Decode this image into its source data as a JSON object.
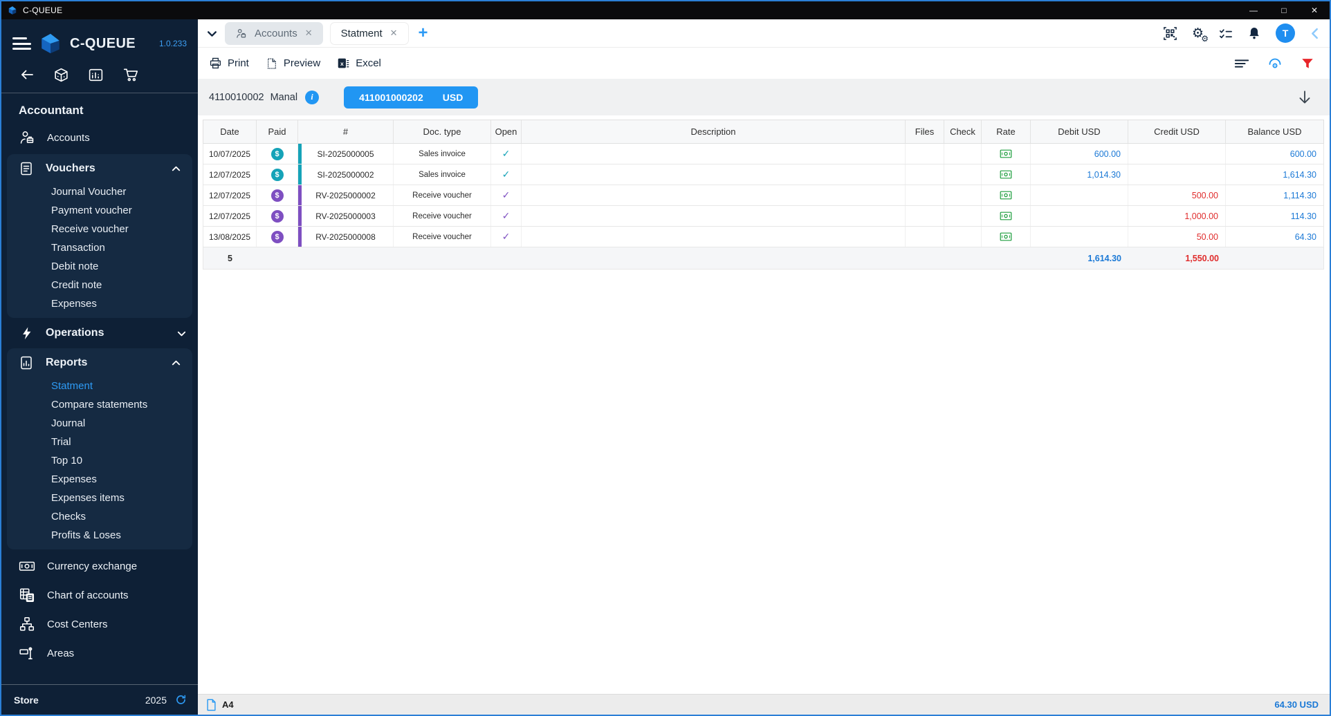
{
  "titlebar": {
    "app_name": "C-QUEUE",
    "minimize": "—",
    "maximize": "□",
    "close": "✕"
  },
  "sidebar": {
    "brand": "C-QUEUE",
    "version": "1.0.233",
    "heading": "Accountant",
    "accounts_label": "Accounts",
    "vouchers": {
      "label": "Vouchers",
      "items": [
        "Journal Voucher",
        "Payment voucher",
        "Receive voucher",
        "Transaction",
        "Debit note",
        "Credit note",
        "Expenses"
      ]
    },
    "operations_label": "Operations",
    "reports": {
      "label": "Reports",
      "items": [
        "Statment",
        "Compare statements",
        "Journal",
        "Trial",
        "Top 10",
        "Expenses",
        "Expenses items",
        "Checks",
        "Profits & Loses"
      ]
    },
    "links": [
      "Currency exchange",
      "Chart of accounts",
      "Cost Centers",
      "Areas"
    ],
    "footer": {
      "store": "Store",
      "year": "2025"
    }
  },
  "tabs": {
    "accounts": "Accounts",
    "statement": "Statment",
    "close": "✕",
    "add": "+"
  },
  "header_icons": {
    "avatar_letter": "T",
    "gear": "⚙"
  },
  "toolbar": {
    "print": "Print",
    "preview": "Preview",
    "excel": "Excel"
  },
  "account_bar": {
    "code": "4110010002",
    "name": "Manal",
    "info": "i",
    "number": "411001000202",
    "currency": "USD"
  },
  "table": {
    "headers": [
      "Date",
      "Paid",
      "#",
      "Doc. type",
      "Open",
      "Description",
      "Files",
      "Check",
      "Rate",
      "Debit USD",
      "Credit USD",
      "Balance USD"
    ],
    "glyphs": {
      "dollar": "$",
      "check": "✓"
    },
    "rows": [
      {
        "date": "10/07/2025",
        "no": "SI-2025000005",
        "type": "Sales invoice",
        "debit": "600.00",
        "credit": "",
        "balance": "600.00",
        "color": "#16a3b8"
      },
      {
        "date": "12/07/2025",
        "no": "SI-2025000002",
        "type": "Sales invoice",
        "debit": "1,014.30",
        "credit": "",
        "balance": "1,614.30",
        "color": "#16a3b8"
      },
      {
        "date": "12/07/2025",
        "no": "RV-2025000002",
        "type": "Receive voucher",
        "debit": "",
        "credit": "500.00",
        "balance": "1,114.30",
        "color": "#7e4fc1"
      },
      {
        "date": "12/07/2025",
        "no": "RV-2025000003",
        "type": "Receive voucher",
        "debit": "",
        "credit": "1,000.00",
        "balance": "114.30",
        "color": "#7e4fc1"
      },
      {
        "date": "13/08/2025",
        "no": "RV-2025000008",
        "type": "Receive voucher",
        "debit": "",
        "credit": "50.00",
        "balance": "64.30",
        "color": "#7e4fc1"
      }
    ],
    "summary": {
      "count": "5",
      "debit_total": "1,614.30",
      "credit_total": "1,550.00"
    }
  },
  "statusbar": {
    "page_size": "A4",
    "total": "64.30 USD"
  },
  "colors": {
    "accent": "#2196f3",
    "sales_invoice": "#16a3b8",
    "receive_voucher": "#7e4fc1",
    "debit_text": "#1b79d6",
    "credit_text": "#e02d2d",
    "filter_red": "#e8262a",
    "rate_green": "#1e9e3e",
    "sidebar_bg": "#0e2036"
  }
}
